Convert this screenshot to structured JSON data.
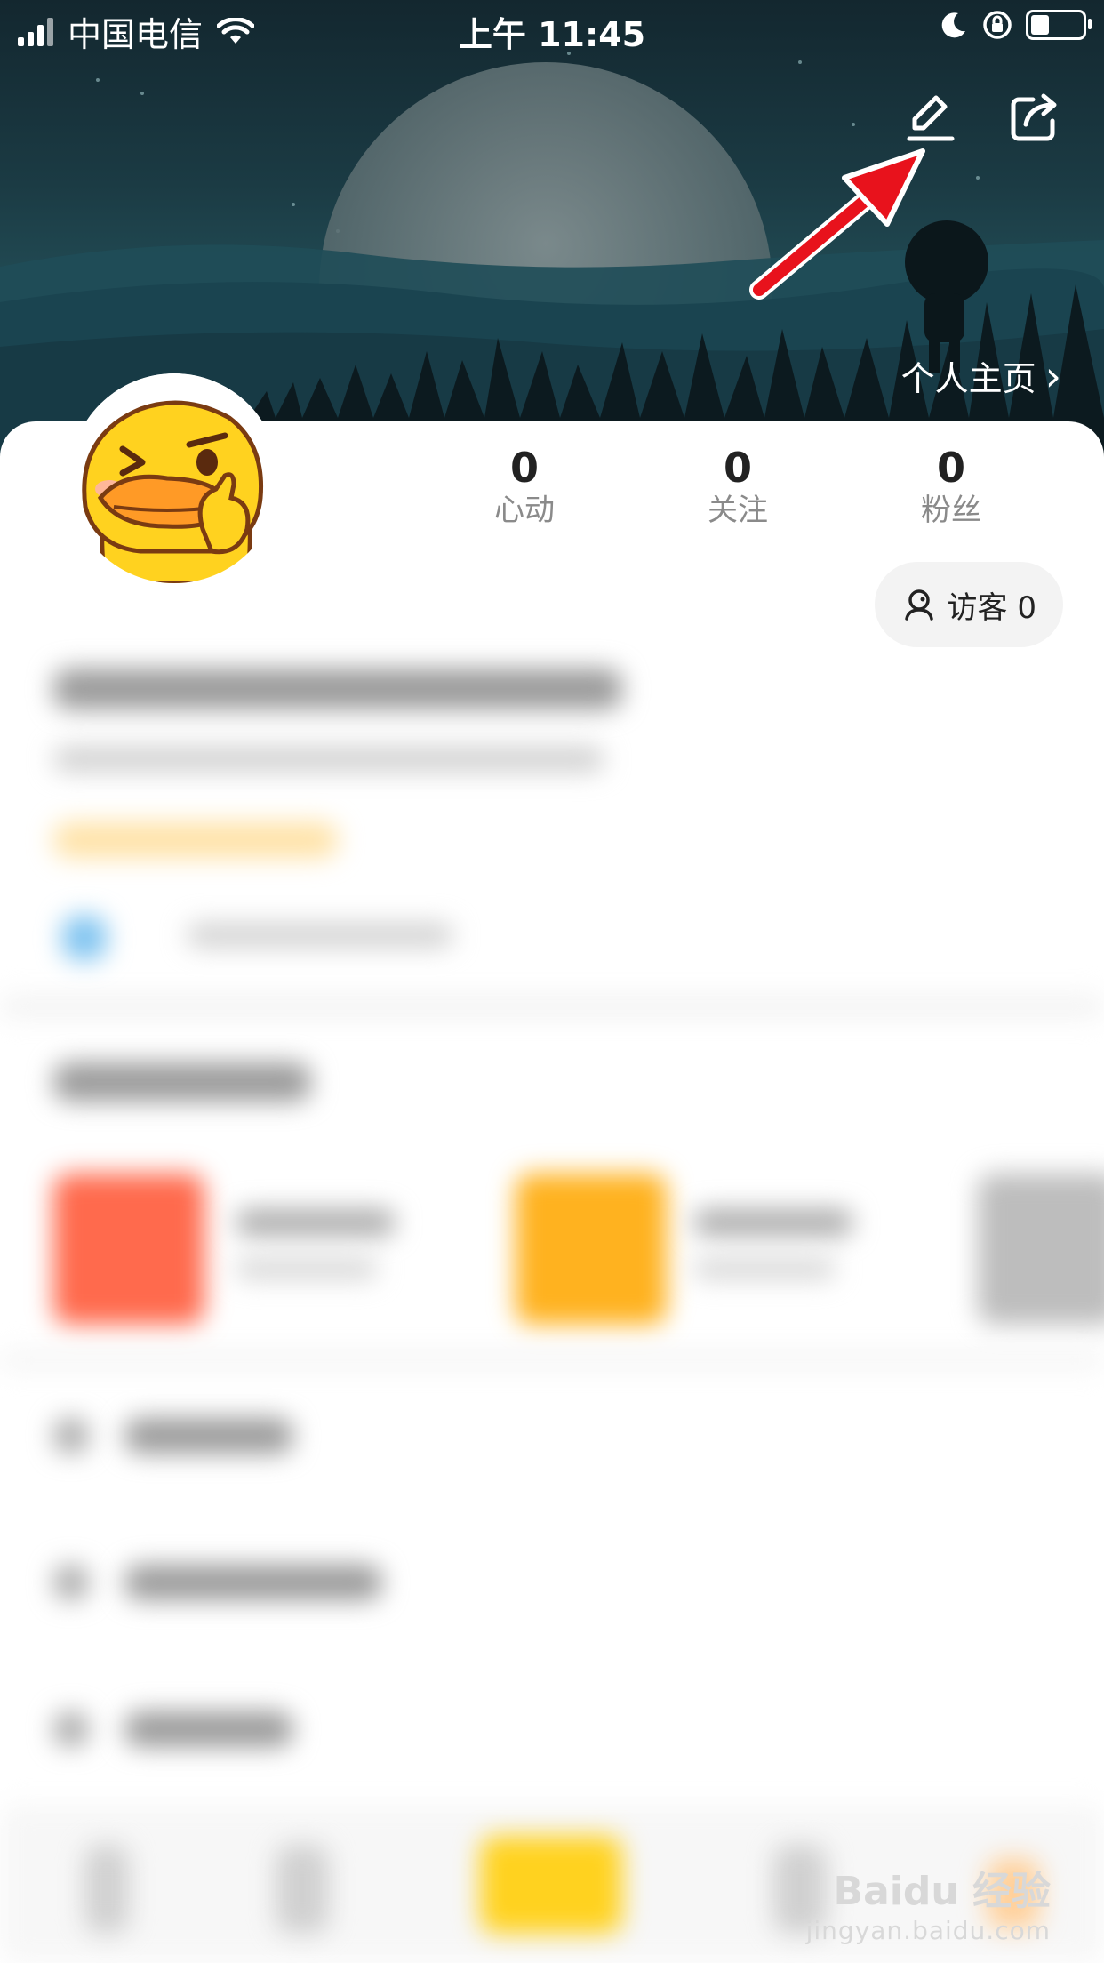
{
  "status_bar": {
    "carrier": "中国电信",
    "time": "上午 11:45"
  },
  "header": {
    "edit_icon": "pencil-edit-icon",
    "share_icon": "share-icon",
    "homepage_link": "个人主页",
    "chevron": "›",
    "annotation_color": "#e8121c"
  },
  "stats": [
    {
      "value": "0",
      "label": "心动"
    },
    {
      "value": "0",
      "label": "关注"
    },
    {
      "value": "0",
      "label": "粉丝"
    }
  ],
  "visitor": {
    "label": "访客 0"
  },
  "watermark": {
    "brand": "Baidu 经验",
    "url": "jingyan.baidu.com"
  },
  "colors": {
    "accent_yellow": "#ffd21f",
    "red_tile": "#ff6a4d",
    "orange_tile": "#ffb21f"
  }
}
